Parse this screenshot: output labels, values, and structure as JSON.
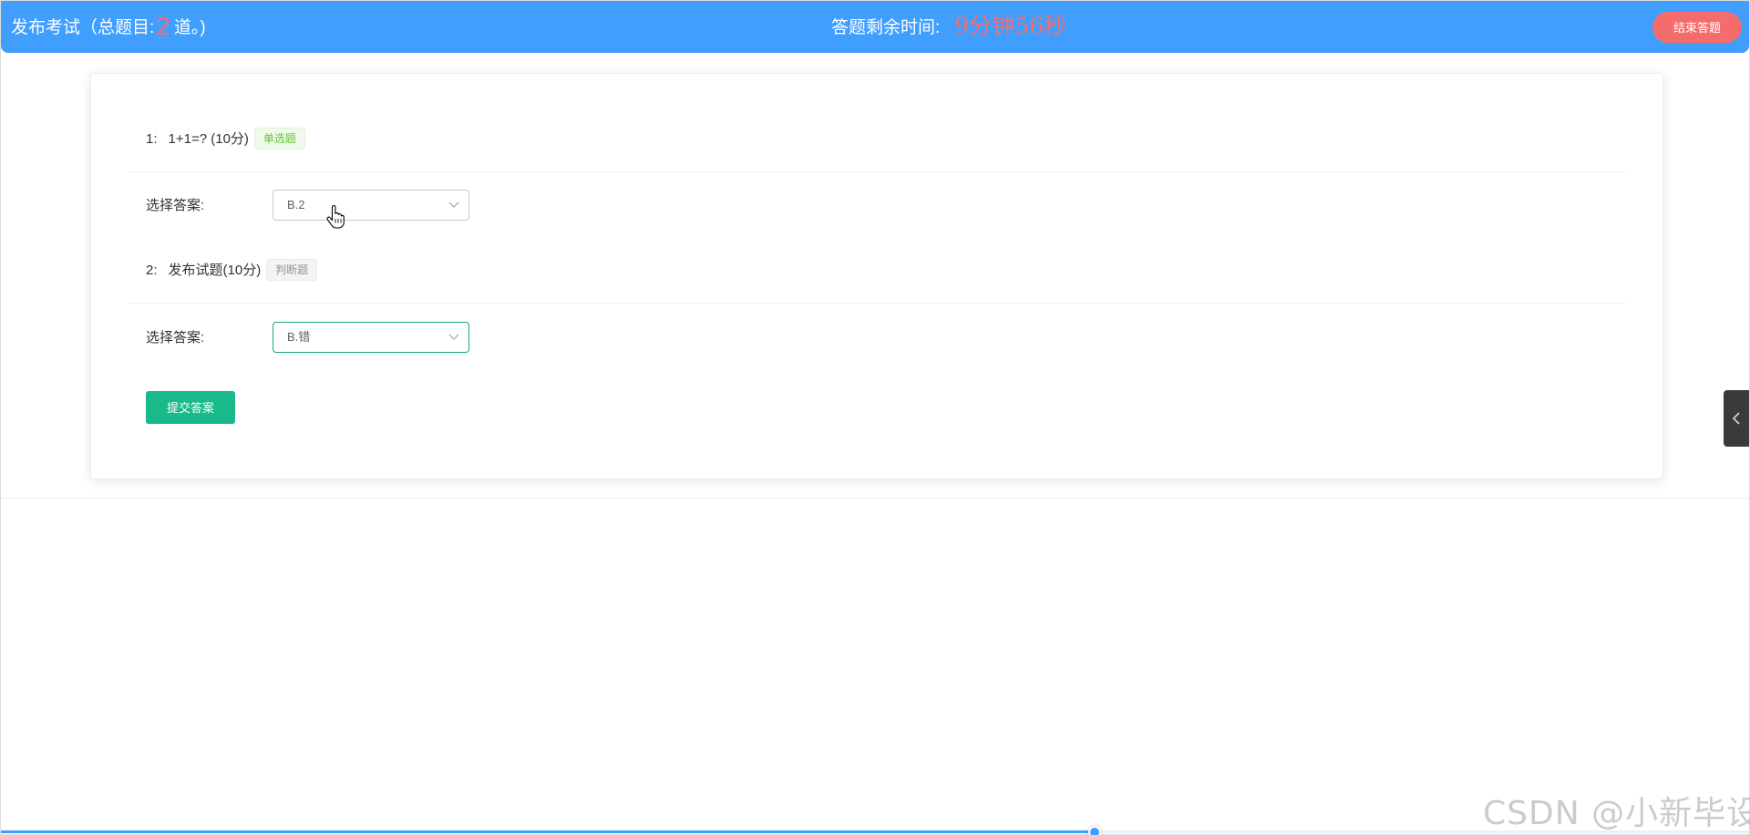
{
  "header": {
    "title_prefix": "发布考试（总题目:",
    "question_count": "2",
    "title_suffix": "道。)",
    "time_label": "答题剩余时间:",
    "time_value": "9分钟56秒",
    "end_button_label": "结束答题"
  },
  "questions": [
    {
      "number": "1:",
      "text": "1+1=? (10分)",
      "type_tag": "单选题",
      "answer_label": "选择答案:",
      "selected_value": "B.2"
    },
    {
      "number": "2:",
      "text": "发布试题(10分)",
      "type_tag": "判断题",
      "answer_label": "选择答案:",
      "selected_value": "B.错"
    }
  ],
  "submit_button_label": "提交答案",
  "watermark": "CSDN @小新毕设",
  "progress": {
    "fraction": 0.625
  },
  "colors": {
    "header_bg": "#409eff",
    "accent_red": "#f56c6c",
    "submit_green": "#18b98a",
    "focus_green": "#17a673",
    "single_tag_green": "#67c23a",
    "judge_tag_gray": "#909399"
  },
  "icons": {
    "select_arrow": "chevron-down-icon",
    "side_tab": "chevron-left-icon",
    "cursor": "hand-pointer-icon"
  }
}
